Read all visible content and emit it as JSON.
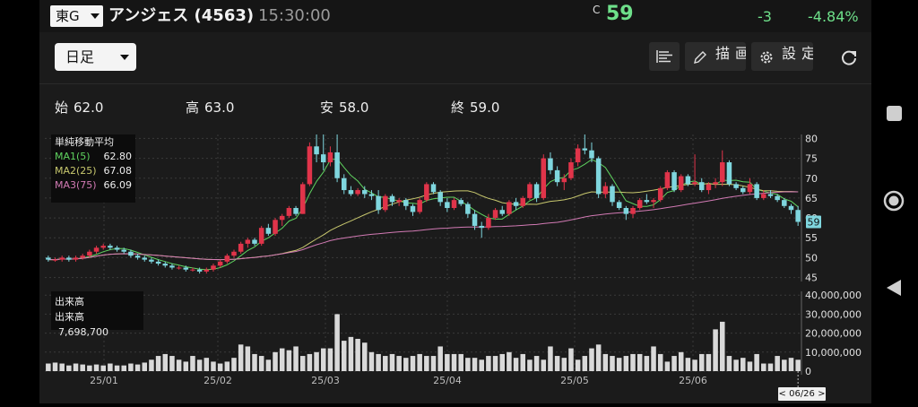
{
  "header": {
    "exchange": "東G",
    "stock_name": "アンジェス (4563)",
    "time": "15:30:00",
    "c_mark": "C",
    "price": "59",
    "change": "-3",
    "change_pct": "-4.84%",
    "change_color": "#6ee08a"
  },
  "toolbar": {
    "period": "日足",
    "draw_label": "描画",
    "settings_label": "設定"
  },
  "ohlc": {
    "open_label": "始",
    "open": "62.0",
    "high_label": "高",
    "high": "63.0",
    "low_label": "安",
    "low": "58.0",
    "close_label": "終",
    "close": "59.0"
  },
  "ma_legend": {
    "title": "単純移動平均",
    "items": [
      {
        "name": "MA1(5)",
        "value": "62.80",
        "color": "#5fd35f"
      },
      {
        "name": "MA2(25)",
        "value": "67.08",
        "color": "#c8c86e"
      },
      {
        "name": "MA3(75)",
        "value": "66.09",
        "color": "#d27ab4"
      }
    ]
  },
  "volume_legend": {
    "title": "出来高",
    "label": "出来高",
    "value": "7,698,700"
  },
  "date_tag": "< 06/26 >",
  "chart_data": {
    "type": "candlestick",
    "price_ticks": [
      "80",
      "75",
      "70",
      "65",
      "60",
      "55",
      "50",
      "45"
    ],
    "price_range": [
      44,
      81
    ],
    "volume_ticks": [
      "40,000,000",
      "30,000,000",
      "20,000,000",
      "10,000,000",
      "0"
    ],
    "volume_range": [
      0,
      42000000
    ],
    "x_ticks": [
      "25/01",
      "25/02",
      "25/03",
      "25/04",
      "25/05",
      "25/06"
    ],
    "last_price_label": "59",
    "up_color": "#e0344a",
    "down_color": "#7fd6de",
    "candles": [
      [
        50,
        50.5,
        49,
        49.5
      ],
      [
        49.5,
        50,
        49,
        49.5
      ],
      [
        49.5,
        50.5,
        49,
        50
      ],
      [
        50,
        50.5,
        49,
        49.5
      ],
      [
        49.5,
        50.5,
        49,
        50
      ],
      [
        50,
        51,
        49.5,
        50.5
      ],
      [
        50.5,
        52,
        50,
        51.5
      ],
      [
        51.5,
        53,
        51,
        52.5
      ],
      [
        52.5,
        53.5,
        52,
        53
      ],
      [
        53,
        53.5,
        52,
        52.5
      ],
      [
        52.5,
        53,
        51.5,
        52
      ],
      [
        52,
        52.5,
        51,
        51.5
      ],
      [
        51.5,
        52,
        50,
        50.5
      ],
      [
        50.5,
        51,
        49.5,
        50
      ],
      [
        50,
        50.5,
        49,
        49.5
      ],
      [
        49.5,
        50,
        48.5,
        49
      ],
      [
        49,
        49.5,
        48,
        48.5
      ],
      [
        48.5,
        49,
        47.5,
        48
      ],
      [
        48,
        48.5,
        47,
        47.5
      ],
      [
        47.5,
        48,
        47,
        47.5
      ],
      [
        47.5,
        48,
        46.5,
        47
      ],
      [
        47,
        47.5,
        46.5,
        47
      ],
      [
        47,
        47.5,
        46,
        46.5
      ],
      [
        46.5,
        47.5,
        46,
        47
      ],
      [
        47,
        48.5,
        46.5,
        48
      ],
      [
        48,
        49.5,
        47.5,
        49
      ],
      [
        49,
        51,
        48.5,
        50.5
      ],
      [
        50.5,
        52,
        50,
        51.5
      ],
      [
        51.5,
        54,
        51,
        53.5
      ],
      [
        53.5,
        55,
        52.5,
        54.5
      ],
      [
        54.5,
        55,
        53,
        53.5
      ],
      [
        53.5,
        58,
        53,
        57.5
      ],
      [
        57.5,
        58.5,
        55.5,
        56
      ],
      [
        56,
        60,
        55.5,
        59.5
      ],
      [
        59.5,
        61,
        58,
        60.5
      ],
      [
        60.5,
        63,
        60,
        62.5
      ],
      [
        62.5,
        63,
        60.5,
        61
      ],
      [
        61,
        69,
        61,
        68.5
      ],
      [
        68.5,
        79,
        68,
        78
      ],
      [
        78,
        81,
        74,
        76
      ],
      [
        76,
        81,
        72,
        74
      ],
      [
        74,
        78,
        73,
        76.5
      ],
      [
        76.5,
        81,
        69,
        70
      ],
      [
        70,
        71,
        66,
        67
      ],
      [
        67,
        68,
        65.5,
        66
      ],
      [
        66,
        67.5,
        65.5,
        67
      ],
      [
        67,
        68,
        65,
        66
      ],
      [
        66,
        67,
        64.5,
        65.5
      ],
      [
        65.5,
        67,
        61,
        62
      ],
      [
        62,
        66,
        61.5,
        65.5
      ],
      [
        65.5,
        66,
        63,
        64
      ],
      [
        64,
        65,
        63,
        64.5
      ],
      [
        64.5,
        65,
        62,
        63
      ],
      [
        63,
        63.5,
        60.5,
        61.5
      ],
      [
        61.5,
        65,
        61,
        64.5
      ],
      [
        64.5,
        69,
        64,
        68.5
      ],
      [
        68.5,
        69,
        66,
        66.5
      ],
      [
        66.5,
        67,
        63,
        64
      ],
      [
        64,
        65,
        61.5,
        62.5
      ],
      [
        62.5,
        65,
        62,
        64.5
      ],
      [
        64.5,
        65,
        63,
        63.5
      ],
      [
        63.5,
        64,
        60,
        61
      ],
      [
        61,
        62,
        57,
        58
      ],
      [
        58,
        59,
        55,
        57.5
      ],
      [
        57.5,
        61,
        57,
        60
      ],
      [
        60,
        62.5,
        59.5,
        62
      ],
      [
        62,
        63,
        60.5,
        61
      ],
      [
        61,
        64.5,
        60.5,
        64
      ],
      [
        64,
        65,
        62,
        63
      ],
      [
        63,
        65.5,
        62.5,
        65
      ],
      [
        65,
        69,
        64.5,
        68.5
      ],
      [
        68.5,
        69,
        64,
        65
      ],
      [
        65,
        76,
        64.5,
        75
      ],
      [
        75,
        76.5,
        71,
        72
      ],
      [
        72,
        73,
        68,
        69
      ],
      [
        69,
        71,
        67,
        70
      ],
      [
        70,
        75,
        69.5,
        74
      ],
      [
        74,
        78.5,
        73,
        77.5
      ],
      [
        77.5,
        81,
        76,
        77
      ],
      [
        77,
        79,
        74,
        75
      ],
      [
        75,
        75.5,
        65,
        66
      ],
      [
        66,
        69,
        65,
        68
      ],
      [
        68,
        68.5,
        63,
        64
      ],
      [
        64,
        64.5,
        62,
        62.5
      ],
      [
        62.5,
        63,
        59.5,
        61
      ],
      [
        61,
        63,
        60,
        62.5
      ],
      [
        62.5,
        65,
        62,
        64.5
      ],
      [
        64.5,
        66,
        63.5,
        64
      ],
      [
        64,
        65,
        62.5,
        64.5
      ],
      [
        64.5,
        68,
        64,
        67.5
      ],
      [
        67.5,
        72,
        67,
        71.5
      ],
      [
        71.5,
        72,
        66.5,
        67
      ],
      [
        67,
        71,
        66.5,
        70.5
      ],
      [
        70.5,
        71,
        68,
        68.5
      ],
      [
        68.5,
        76,
        68,
        69
      ],
      [
        69,
        70,
        66.5,
        67
      ],
      [
        67,
        69,
        66,
        68.5
      ],
      [
        68.5,
        70,
        67.5,
        69
      ],
      [
        69,
        77,
        68,
        74
      ],
      [
        74,
        74.5,
        68,
        68.5
      ],
      [
        68.5,
        69,
        67,
        67.5
      ],
      [
        67.5,
        68,
        66,
        66.5
      ],
      [
        66.5,
        70,
        66,
        68.5
      ],
      [
        68.5,
        69,
        64.5,
        65
      ],
      [
        65,
        67,
        64.5,
        66
      ],
      [
        66,
        67,
        65,
        65.5
      ],
      [
        65.5,
        66,
        64,
        64.5
      ],
      [
        64.5,
        65,
        62.5,
        63
      ],
      [
        63,
        63.5,
        61,
        62
      ],
      [
        62,
        63,
        58,
        59
      ]
    ],
    "volumes": [
      4,
      4.5,
      4,
      3,
      4,
      3.5,
      3,
      3.5,
      3,
      4,
      3,
      3,
      4,
      3.5,
      4.5,
      6,
      8,
      9,
      8,
      6,
      5,
      8,
      6,
      7,
      5,
      4,
      5,
      7,
      14,
      13,
      9,
      8,
      6,
      10,
      12,
      11,
      13,
      8,
      9,
      10,
      12,
      12,
      30,
      16,
      18,
      17,
      15,
      10,
      9,
      8,
      9,
      8,
      7,
      8,
      9,
      8,
      8,
      13,
      9,
      9,
      9,
      7,
      7,
      6,
      8,
      8,
      9,
      10,
      7,
      9,
      6,
      8,
      6,
      13,
      8,
      7,
      12,
      6,
      8,
      12,
      14,
      9,
      8,
      7,
      8,
      9,
      9,
      8,
      13,
      9,
      5,
      8,
      10,
      7,
      6,
      9,
      9,
      22,
      26,
      8,
      6,
      7,
      5,
      9,
      4,
      4,
      8,
      6,
      7,
      6,
      7,
      8
    ]
  }
}
